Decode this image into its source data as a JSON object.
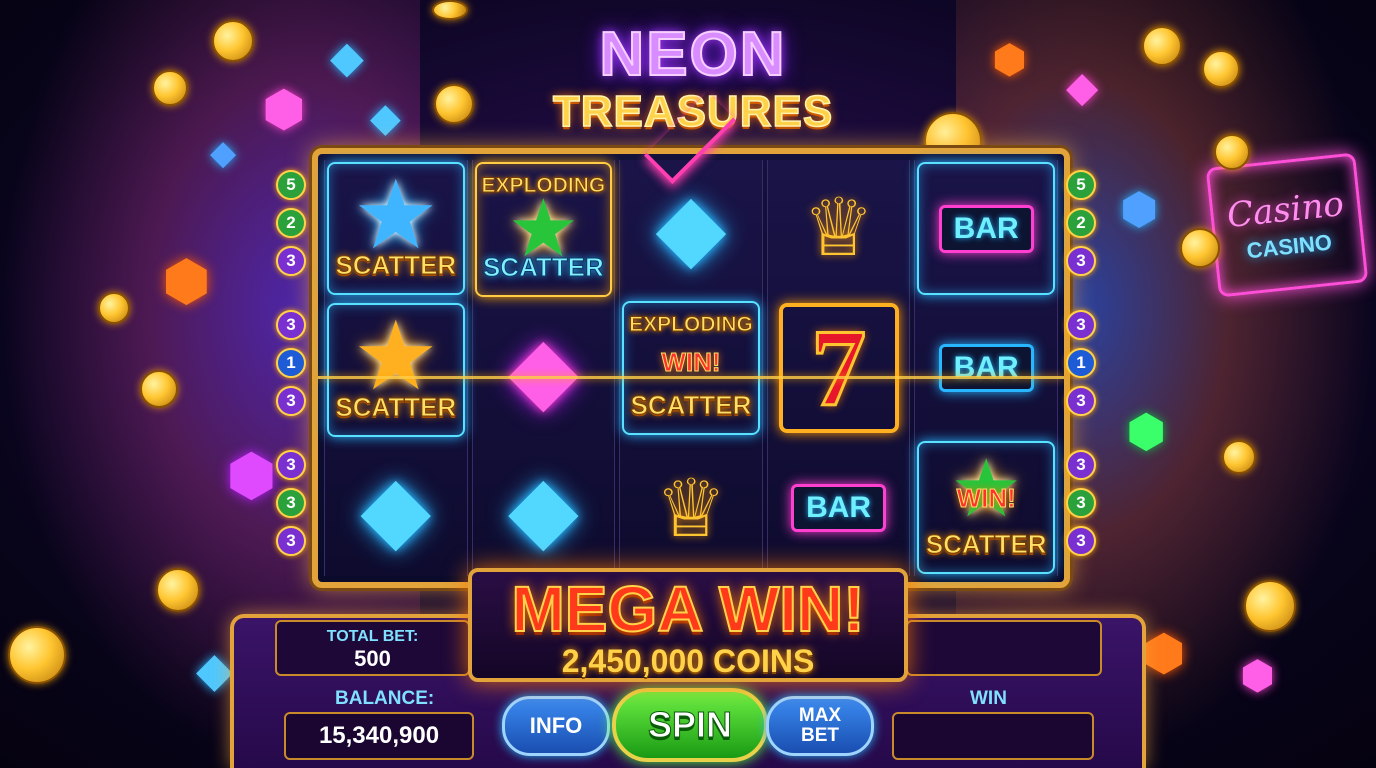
{
  "title": {
    "line1": "NEON",
    "line2": "TREASURES"
  },
  "casino_sign": {
    "script": "Casino",
    "word": "CASINO"
  },
  "line_badges": {
    "left": [
      "5",
      "2",
      "3",
      "3",
      "1",
      "3",
      "3",
      "3",
      "3"
    ],
    "right": [
      "5",
      "2",
      "3",
      "3",
      "1",
      "3",
      "3",
      "3",
      "3"
    ]
  },
  "reels": [
    [
      {
        "symbol": "blue-star",
        "label": "SCATTER"
      },
      {
        "symbol": "gold-star",
        "label": "SCATTER"
      },
      {
        "symbol": "blue-diamond",
        "label": ""
      }
    ],
    [
      {
        "symbol": "green-star",
        "top": "EXPLODING",
        "label": "SCATTER"
      },
      {
        "symbol": "pink-diamond",
        "label": ""
      },
      {
        "symbol": "blue-diamond",
        "label": ""
      }
    ],
    [
      {
        "symbol": "blue-diamond",
        "label": ""
      },
      {
        "symbol": "scatter-win",
        "top": "EXPLODING",
        "win": "WIN!",
        "label": "SCATTER"
      },
      {
        "symbol": "crown",
        "label": ""
      }
    ],
    [
      {
        "symbol": "crown",
        "label": ""
      },
      {
        "symbol": "seven",
        "text": "7"
      },
      {
        "symbol": "bar",
        "text": "BAR"
      }
    ],
    [
      {
        "symbol": "bar",
        "text": "BAR"
      },
      {
        "symbol": "bar",
        "text": "BAR"
      },
      {
        "symbol": "green-star-win",
        "win": "WIN!",
        "label": "SCATTER"
      }
    ]
  ],
  "mega_win": {
    "headline": "MEGA WIN!",
    "amount": "2,450,000 COINS"
  },
  "panel": {
    "total_bet_label": "TOTAL BET:",
    "total_bet_value": "500",
    "balance_label": "BALANCE:",
    "balance_value": "15,340,900",
    "win_label": "WIN",
    "win_value": "",
    "info_button": "INFO",
    "spin_button": "SPIN",
    "max_bet_line1": "MAX",
    "max_bet_line2": "BET"
  },
  "colors": {
    "gold": "#e2a43a",
    "neon_blue": "#27b6ff",
    "neon_pink": "#ff3fd0",
    "spin_green": "#1a9a14"
  }
}
